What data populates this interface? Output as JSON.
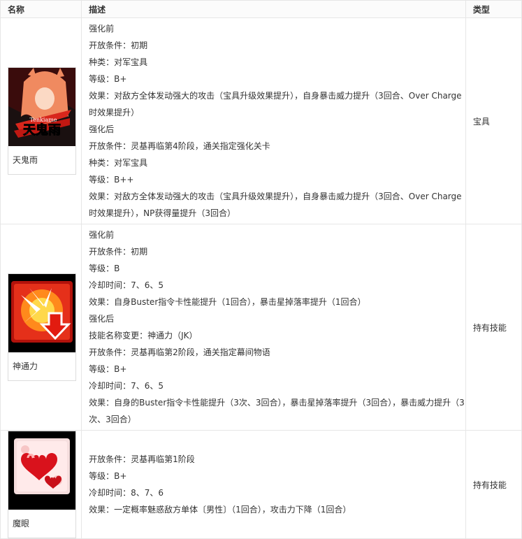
{
  "headers": {
    "name": "名称",
    "desc": "描述",
    "type": "类型"
  },
  "rows": [
    {
      "name": "天鬼雨",
      "icon": "noble-phantasm-art",
      "type": "宝具",
      "lines": [
        "强化前",
        "开放条件：初期",
        "种类：对军宝具",
        "等级：B+",
        "效果：对敌方全体发动强大的攻击（宝具升级效果提升），自身暴击威力提升（3回合、Over Charge时效果提升）",
        "强化后",
        "开放条件：灵基再临第4阶段，通关指定强化关卡",
        "种类：对军宝具",
        "等级：B++",
        "效果：对敌方全体发动强大的攻击（宝具升级效果提升），自身暴击威力提升（3回合、Over Charge时效果提升），NP获得量提升（3回合）"
      ],
      "art_text": "天鬼雨",
      "art_subtext": "Tenkiame"
    },
    {
      "name": "神通力",
      "icon": "buster-up-icon",
      "type": "持有技能",
      "lines": [
        "强化前",
        "开放条件：初期",
        "等级：B",
        "冷却时间：7、6、5",
        "效果：自身Buster指令卡性能提升（1回合），暴击星掉落率提升（1回合）",
        "强化后",
        "技能名称变更：神通力（JK）",
        "开放条件：灵基再临第2阶段，通关指定幕间物语",
        "等级：B+",
        "冷却时间：7、6、5",
        "效果：自身的Buster指令卡性能提升（3次、3回合），暴击星掉落率提升（3回合），暴击威力提升（3次、3回合）"
      ]
    },
    {
      "name": "魔眼",
      "icon": "heart-charm-icon",
      "type": "持有技能",
      "lines": [
        "开放条件：灵基再临第1阶段",
        "等级：B+",
        "冷却时间：8、7、6",
        "效果：一定概率魅惑敌方单体〔男性〕（1回合），攻击力下降（1回合）"
      ]
    }
  ]
}
